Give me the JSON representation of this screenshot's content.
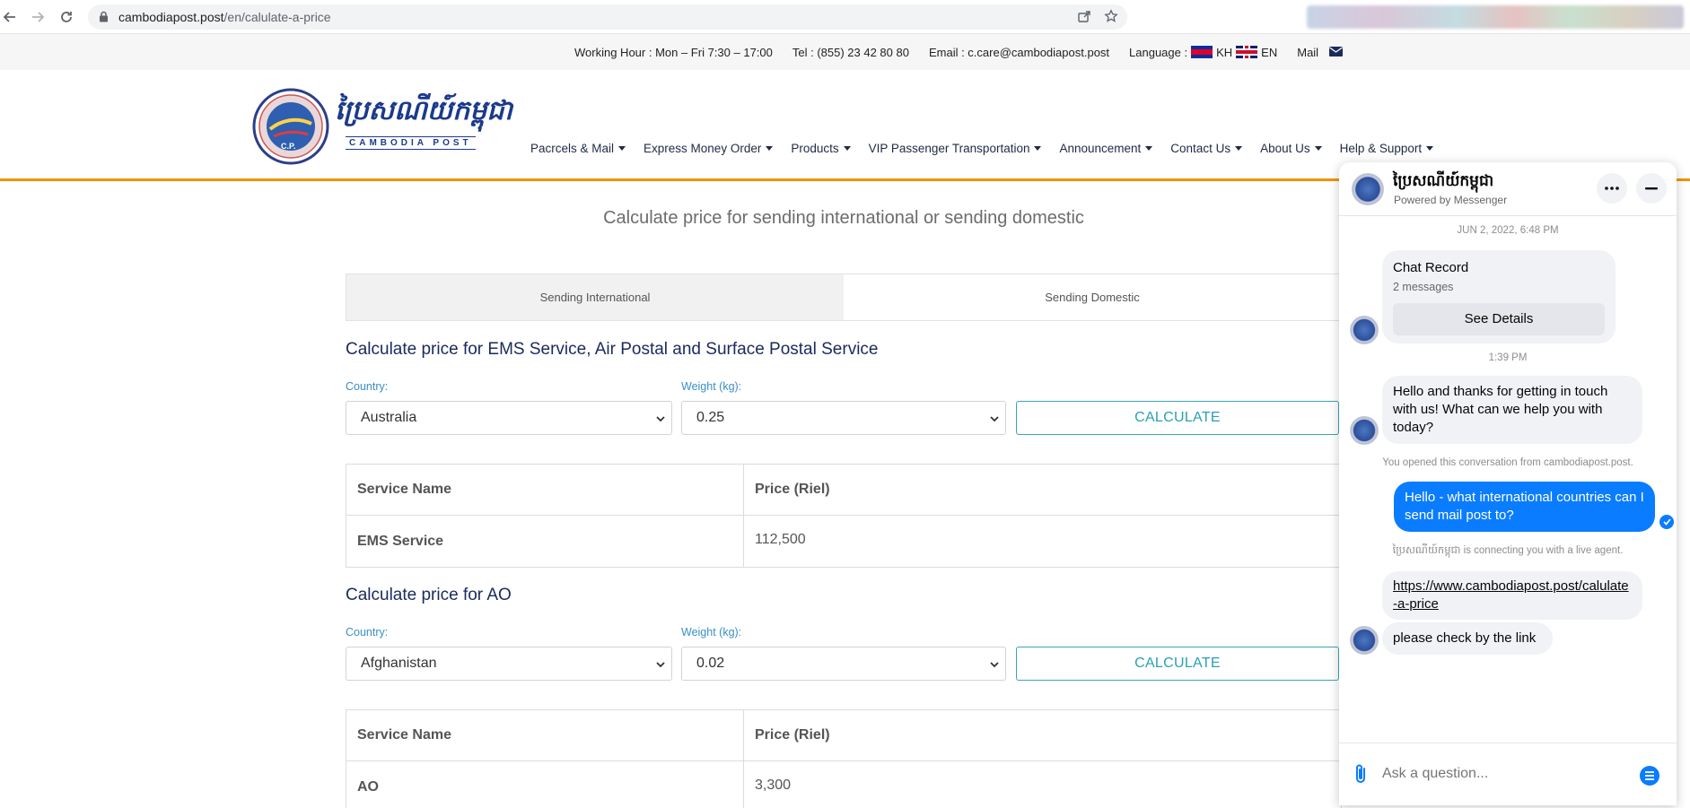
{
  "browser": {
    "url_host": "cambodiapost.post",
    "url_path": "/en/calulate-a-price"
  },
  "topbar": {
    "working_hour": "Working Hour : Mon – Fri 7:30 – 17:00",
    "tel": "Tel : (855) 23 42 80 80",
    "email": "Email : c.care@cambodiapost.post",
    "language_label": "Language :",
    "lang_kh": "KH",
    "lang_en": "EN",
    "mail_label": "Mail"
  },
  "logo": {
    "khmer": "ប្រៃសណីយ៍កម្ពុជា",
    "english": "CAMBODIA POST",
    "emblem": "C.P."
  },
  "menu": [
    {
      "label": "Pacrcels & Mail"
    },
    {
      "label": "Express Money Order"
    },
    {
      "label": "Products"
    },
    {
      "label": "VIP Passenger Transportation"
    },
    {
      "label": "Announcement"
    },
    {
      "label": "Contact Us"
    },
    {
      "label": "About Us"
    },
    {
      "label": "Help & Support"
    }
  ],
  "main": {
    "title": "Calculate price for sending international or sending domestic",
    "tabs": [
      {
        "label": "Sending International",
        "active": true
      },
      {
        "label": "Sending Domestic",
        "active": false
      }
    ],
    "ems": {
      "title": "Calculate price for EMS Service, Air Postal and Surface Postal Service",
      "country_label": "Country:",
      "country_value": "Australia",
      "weight_label": "Weight (kg):",
      "weight_value": "0.25",
      "button": "CALCULATE",
      "headers": [
        "Service Name",
        "Price (Riel)"
      ],
      "rows": [
        {
          "name": "EMS Service",
          "price": "112,500"
        }
      ]
    },
    "ao": {
      "title": "Calculate price for AO",
      "country_label": "Country:",
      "country_value": "Afghanistan",
      "weight_label": "Weight (kg):",
      "weight_value": "0.02",
      "button": "CALCULATE",
      "headers": [
        "Service Name",
        "Price (Riel)"
      ],
      "rows": [
        {
          "name": "AO",
          "price": "3,300"
        }
      ]
    }
  },
  "chat": {
    "name": "ប្រៃសណីយ៍កម្ពុជា",
    "subtitle": "Powered by Messenger",
    "timestamp1": "JUN 2, 2022, 6:48 PM",
    "record_title": "Chat Record",
    "record_count": "2 messages",
    "see_details": "See Details",
    "timestamp2": "1:39 PM",
    "greeting": "Hello and thanks for getting in touch with us! What can we help you with today?",
    "opened_note": "You opened this conversation from cambodiapost.post.",
    "user_msg": "Hello - what international countries can I send mail post to?",
    "connecting_note": "ប្រៃសណីយ៍កម្ពុជា is connecting you with a live agent.",
    "link_msg": "https://www.cambodiapost.post/calulate-a-price",
    "check_msg": "please check by the link",
    "input_placeholder": "Ask a question..."
  },
  "colors": {
    "accent_orange": "#f39200",
    "brand_blue": "#1a2a5c",
    "button_teal": "#2aa0b2",
    "messenger_blue": "#0a7cff"
  }
}
